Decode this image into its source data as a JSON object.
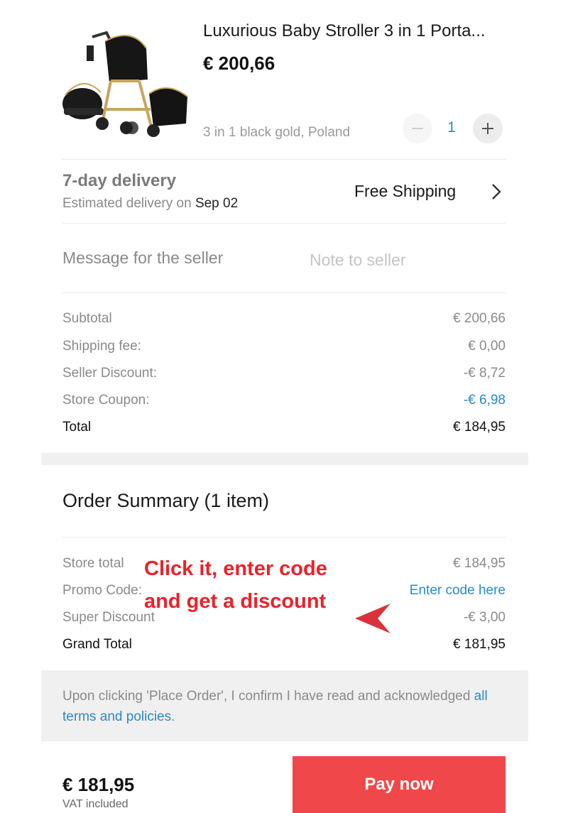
{
  "product": {
    "title": "Luxurious Baby Stroller 3 in 1 Porta...",
    "price": "€ 200,66",
    "variant": "3 in 1 black gold, Poland",
    "quantity": "1",
    "image_icon": "stroller-image"
  },
  "delivery": {
    "title": "7-day delivery",
    "estimated_prefix": "Estimated delivery on",
    "estimated_date": "Sep 02",
    "shipping_label": "Free Shipping"
  },
  "message": {
    "label": "Message for the seller",
    "placeholder": "Note to seller"
  },
  "price_breakdown": [
    {
      "label": "Subtotal",
      "value": "€ 200,66"
    },
    {
      "label": "Shipping fee:",
      "value": "€ 0,00"
    },
    {
      "label": "Seller Discount:",
      "value": "-€ 8,72"
    },
    {
      "label": "Store Coupon:",
      "value": "-€ 6,98"
    },
    {
      "label": "Total",
      "value": "€ 184,95"
    }
  ],
  "order_summary": {
    "heading": "Order Summary (1 item)",
    "rows": [
      {
        "label": "Store total",
        "value": "€ 184,95"
      },
      {
        "label": "Promo Code:",
        "value": "Enter code here"
      },
      {
        "label": "Super Discount",
        "value": "-€ 3,00"
      },
      {
        "label": "Grand Total",
        "value": "€ 181,95"
      }
    ]
  },
  "annotation": {
    "line1": "Click it, enter code",
    "line2": "and get a discount"
  },
  "terms": {
    "text": "Upon clicking 'Place Order', I confirm I have read and acknowledged",
    "link": "all terms and policies",
    "suffix": "."
  },
  "footer": {
    "price": "€ 181,95",
    "sub": "VAT included",
    "pay_label": "Pay now"
  },
  "colors": {
    "accent_blue": "#2a8ac8",
    "pay_red": "#f0484a",
    "annotation_red": "#e8232a"
  }
}
